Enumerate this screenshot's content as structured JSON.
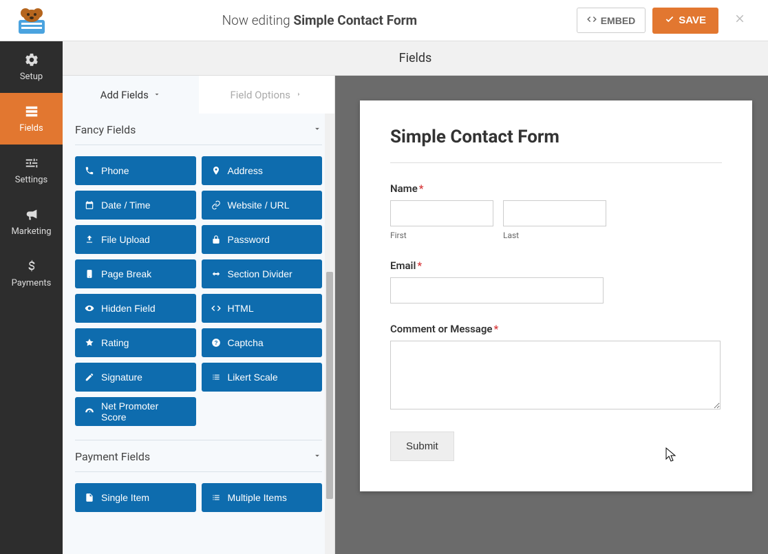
{
  "topbar": {
    "title_prefix": "Now editing ",
    "title_name": "Simple Contact Form",
    "embed": "EMBED",
    "save": "SAVE"
  },
  "nav": {
    "setup": "Setup",
    "fields": "Fields",
    "settings": "Settings",
    "marketing": "Marketing",
    "payments": "Payments"
  },
  "fields_header": "Fields",
  "panel": {
    "tabs": {
      "add": "Add Fields",
      "options": "Field Options"
    },
    "groups": {
      "fancy": {
        "title": "Fancy Fields",
        "items": [
          {
            "icon": "phone",
            "label": "Phone"
          },
          {
            "icon": "address",
            "label": "Address"
          },
          {
            "icon": "calendar",
            "label": "Date / Time"
          },
          {
            "icon": "link",
            "label": "Website / URL"
          },
          {
            "icon": "upload",
            "label": "File Upload"
          },
          {
            "icon": "lock",
            "label": "Password"
          },
          {
            "icon": "page",
            "label": "Page Break"
          },
          {
            "icon": "arrows",
            "label": "Section Divider"
          },
          {
            "icon": "eye",
            "label": "Hidden Field"
          },
          {
            "icon": "code",
            "label": "HTML"
          },
          {
            "icon": "star",
            "label": "Rating"
          },
          {
            "icon": "question",
            "label": "Captcha"
          },
          {
            "icon": "pencil",
            "label": "Signature"
          },
          {
            "icon": "list",
            "label": "Likert Scale"
          },
          {
            "icon": "gauge",
            "label": "Net Promoter Score"
          }
        ]
      },
      "payment": {
        "title": "Payment Fields",
        "items": [
          {
            "icon": "file",
            "label": "Single Item"
          },
          {
            "icon": "list",
            "label": "Multiple Items"
          }
        ]
      }
    }
  },
  "form": {
    "title": "Simple Contact Form",
    "name_label": "Name",
    "first_sub": "First",
    "last_sub": "Last",
    "email_label": "Email",
    "comment_label": "Comment or Message",
    "submit": "Submit",
    "required": "*"
  }
}
